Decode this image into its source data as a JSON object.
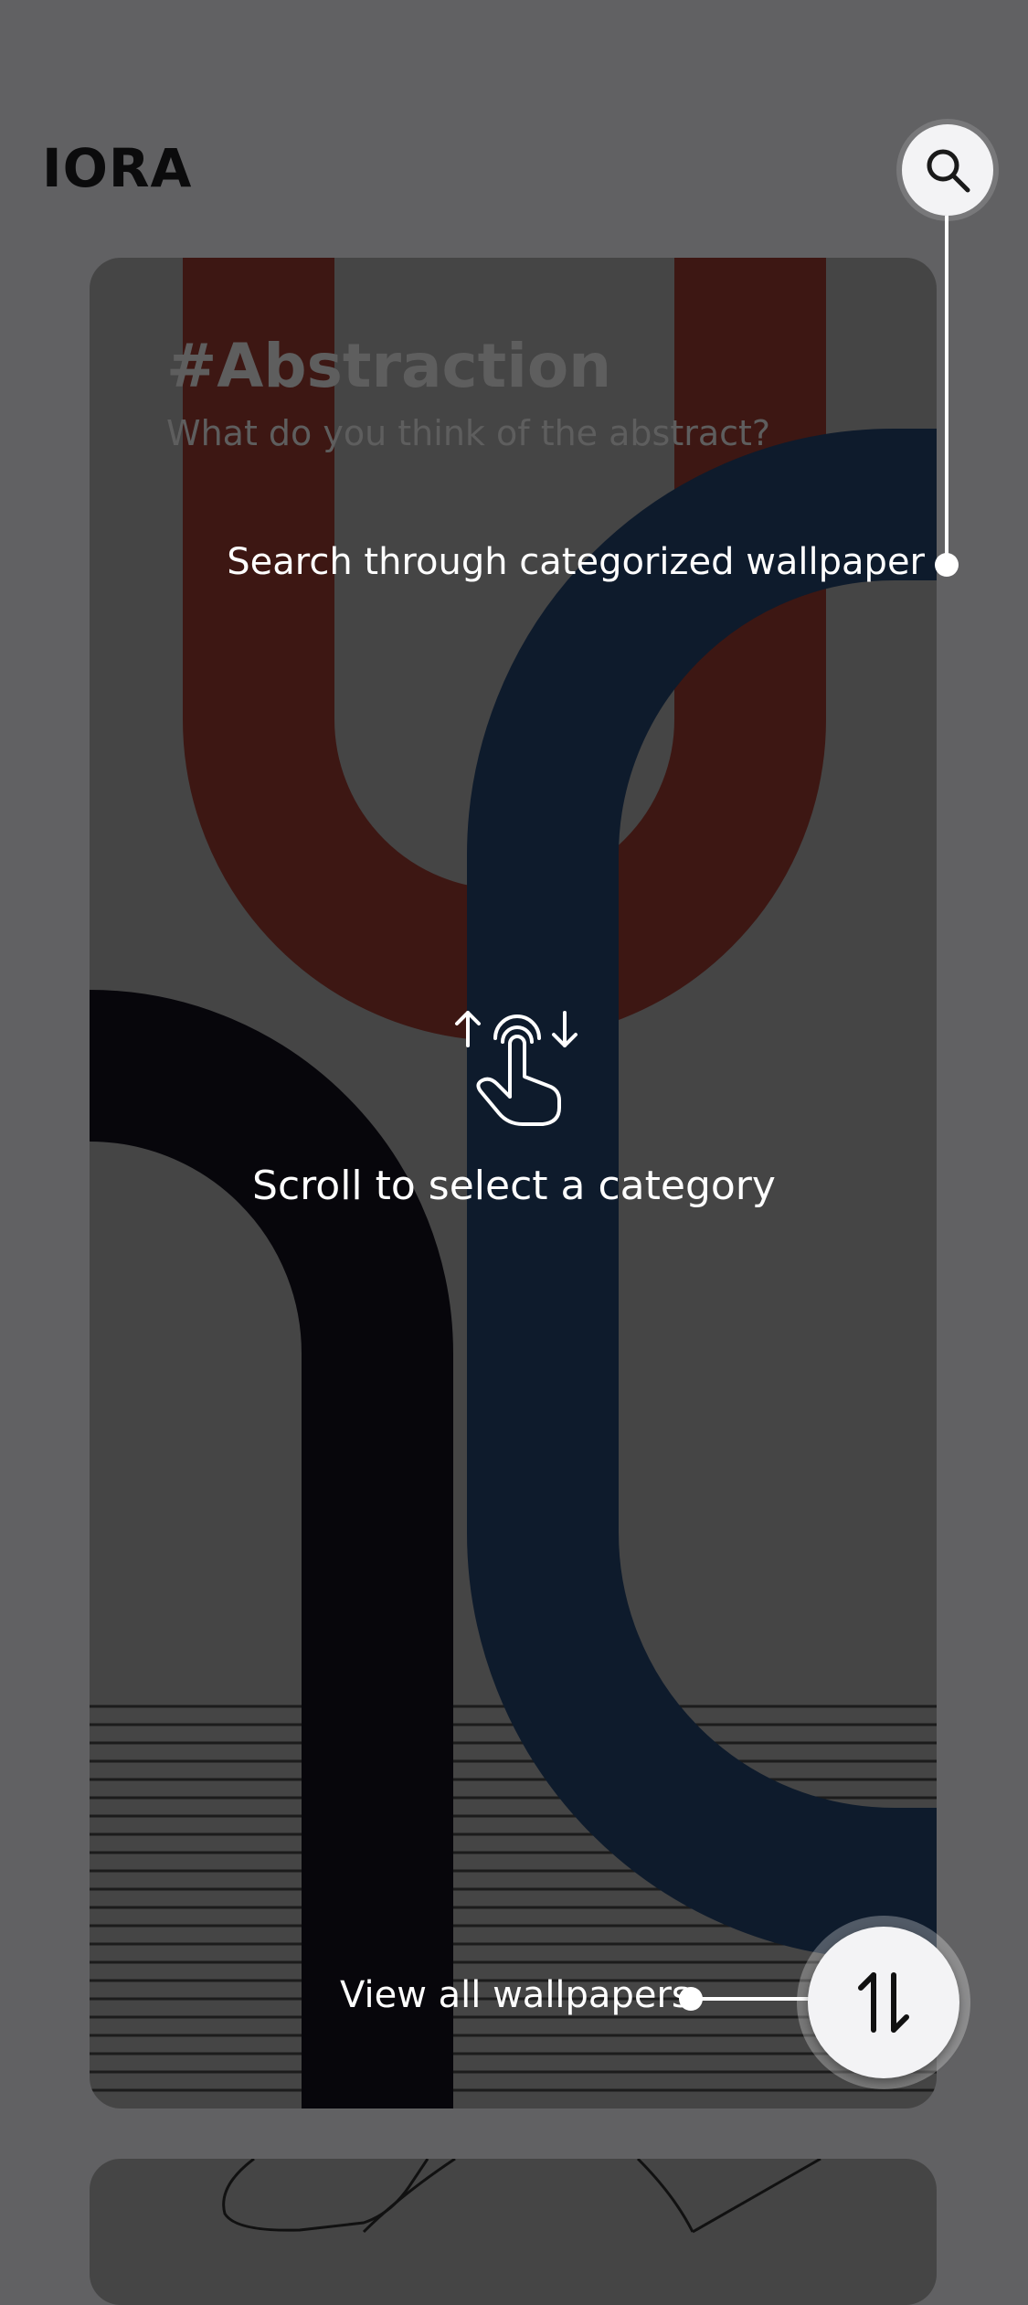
{
  "app": {
    "logo": "IORA"
  },
  "header": {
    "search_icon": "search-icon"
  },
  "card": {
    "title": "#Abstraction",
    "subtitle": "What do you think of the abstract?"
  },
  "coach_marks": {
    "search_hint": "Search through categorized wallpaper",
    "scroll_hint": "Scroll to select a category",
    "scroll_icon": "swipe-vertical-hand-icon",
    "view_all_hint": "View all wallpapers"
  },
  "fab": {
    "icon": "swap-vertical-icon"
  },
  "colors": {
    "overlay_background": "#616163",
    "card_background": "#454545",
    "red_band": "#3d1713",
    "navy_band": "#0e1b2c",
    "black_band": "#07060b",
    "button_background": "#f3f3f5"
  }
}
